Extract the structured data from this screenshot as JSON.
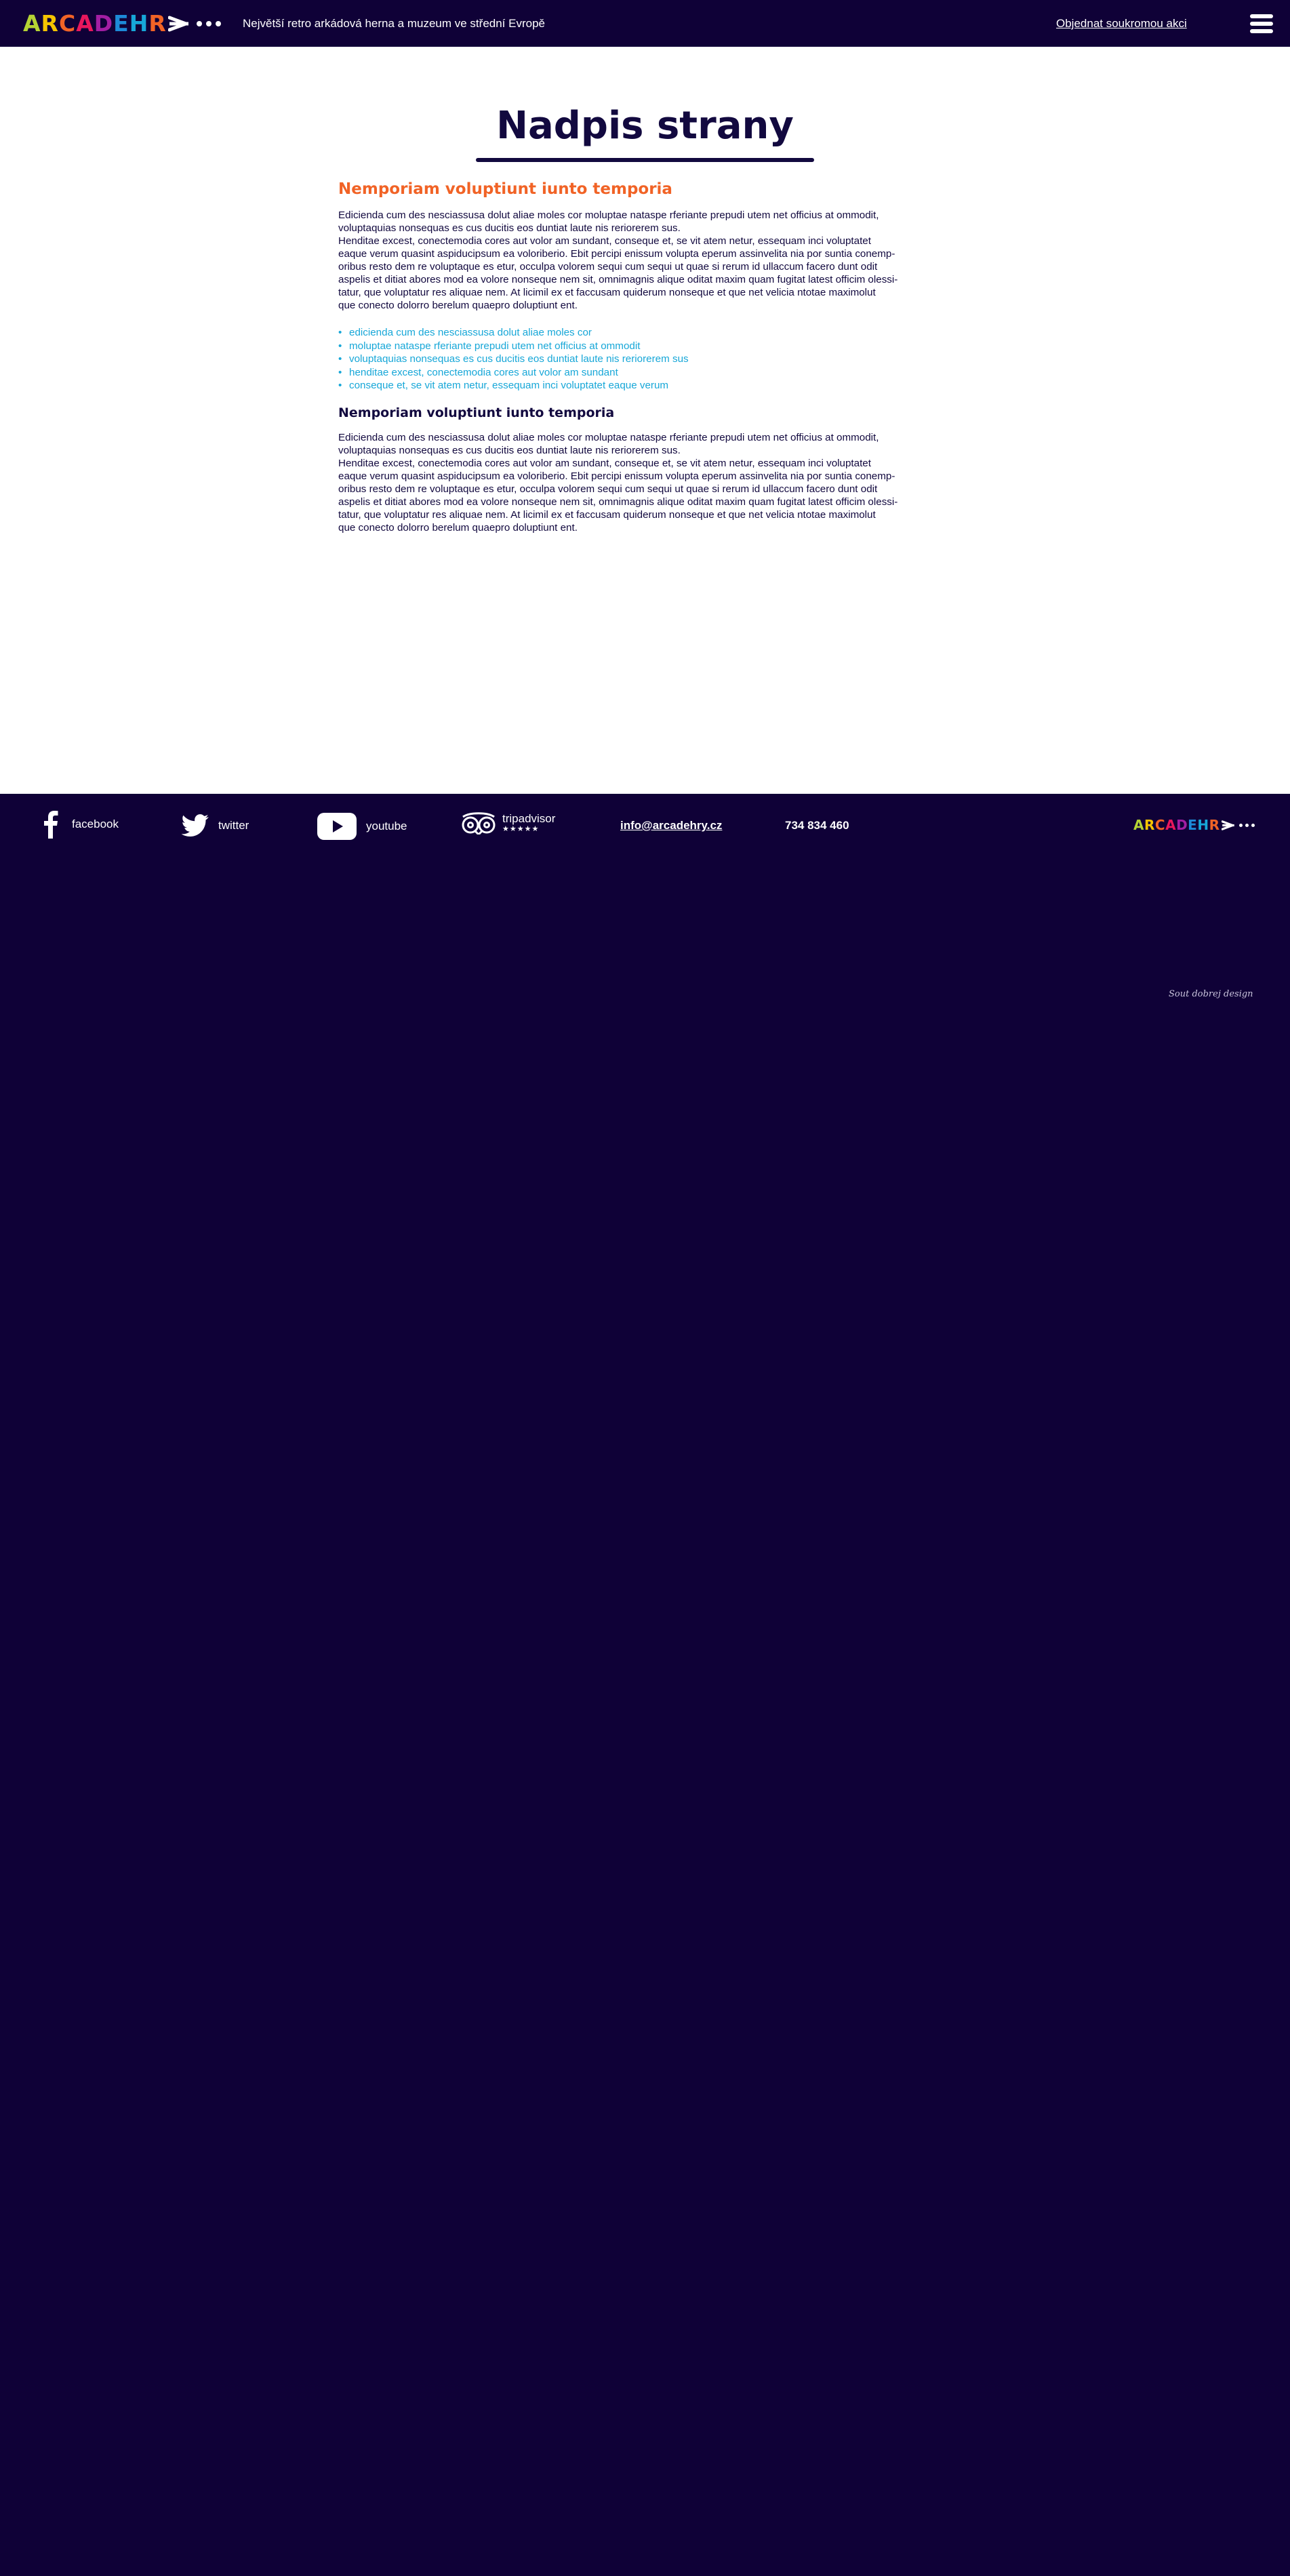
{
  "brand": {
    "letters": [
      {
        "char": "A",
        "color": "#b5d334"
      },
      {
        "char": "R",
        "color": "#f5c400"
      },
      {
        "char": "C",
        "color": "#f16326"
      },
      {
        "char": "A",
        "color": "#e8175d"
      },
      {
        "char": "D",
        "color": "#a21ea3"
      },
      {
        "char": "E",
        "color": "#1d8ad8"
      },
      {
        "char": "H",
        "color": "#17a7d8"
      },
      {
        "char": "R",
        "color": "#f16326"
      }
    ],
    "arrow_color": "#ffffff"
  },
  "header": {
    "tagline": "Největší retro arkádová herna a muzeum ve střední Evropě",
    "cta_link": "Objednat soukromou akci",
    "menu_icon": "hamburger-icon"
  },
  "main": {
    "title": "Nadpis strany",
    "section1": {
      "heading": "Nemporiam voluptiunt iunto temporia",
      "paragraph": [
        "Edicienda cum des nesciassusa dolut aliae moles cor moluptae nataspe rferiante prepudi utem net officius at ommodit,",
        "voluptaquias nonsequas es cus ducitis eos duntiat laute nis reriorerem sus.",
        "Henditae excest, conectemodia cores aut volor am sundant, conseque et, se vit atem netur, essequam inci voluptatet",
        "eaque verum quasint aspiducipsum ea voloriberio. Ebit percipi enissum volupta eperum assinvelita nia por suntia conemp-",
        "oribus resto dem re voluptaque es etur, occulpa volorem sequi cum sequi ut quae si rerum id ullaccum facero dunt odit",
        "aspelis et ditiat abores mod ea volore nonseque nem sit, omnimagnis alique oditat maxim quam fugitat latest officim olessi-",
        "tatur, que voluptatur res aliquae nem. At licimil ex et faccusam quiderum nonseque et que net velicia ntotae maximolut",
        "que conecto dolorro berelum quaepro doluptiunt ent."
      ],
      "bullets": [
        "edicienda cum des nesciassusa dolut aliae moles cor",
        "moluptae nataspe rferiante prepudi utem net officius at ommodit",
        "voluptaquias nonsequas es cus ducitis eos duntiat laute nis reriorerem sus",
        "henditae excest, conectemodia cores aut volor am sundant",
        "conseque et, se vit atem netur, essequam inci voluptatet eaque verum"
      ]
    },
    "section2": {
      "heading": "Nemporiam voluptiunt iunto temporia",
      "paragraph": [
        "Edicienda cum des nesciassusa dolut aliae moles cor moluptae nataspe rferiante prepudi utem net officius at ommodit,",
        "voluptaquias nonsequas es cus ducitis eos duntiat laute nis reriorerem sus.",
        "Henditae excest, conectemodia cores aut volor am sundant, conseque et, se vit atem netur, essequam inci voluptatet",
        "eaque verum quasint aspiducipsum ea voloriberio. Ebit percipi enissum volupta eperum assinvelita nia por suntia conemp-",
        "oribus resto dem re voluptaque es etur, occulpa volorem sequi cum sequi ut quae si rerum id ullaccum facero dunt odit",
        "aspelis et ditiat abores mod ea volore nonseque nem sit, omnimagnis alique oditat maxim quam fugitat latest officim olessi-",
        "tatur, que voluptatur res aliquae nem. At licimil ex et faccusam quiderum nonseque et que net velicia ntotae maximolut",
        "que conecto dolorro berelum quaepro doluptiunt ent."
      ]
    }
  },
  "footer": {
    "facebook": "facebook",
    "twitter": "twitter",
    "youtube": "youtube",
    "tripadvisor": "tripadvisor",
    "tripadvisor_stars": "★★★★★",
    "email": "info@arcadehry.cz",
    "phone": "734 834 460",
    "credit": "Sout dobrej design"
  },
  "colors": {
    "navy": "#0f0137",
    "accent_orange": "#f16326",
    "accent_blue": "#17a7d8",
    "text_dark": "#12093f"
  }
}
